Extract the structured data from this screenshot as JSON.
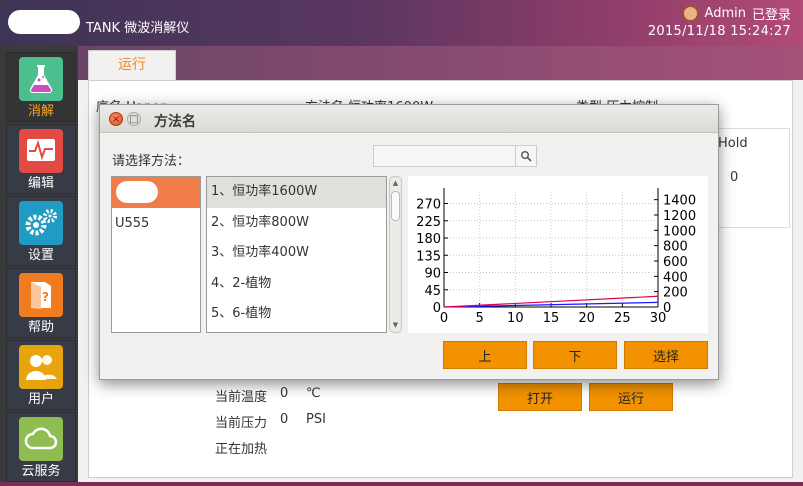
{
  "app": {
    "title": "TANK 微波消解仪",
    "user": "Admin",
    "login_status": "已登录",
    "datetime": "2015/11/18 15:24:27"
  },
  "sidebar": {
    "items": [
      {
        "label": "消解",
        "icon": "flask-icon",
        "active": true
      },
      {
        "label": "编辑",
        "icon": "waveform-edit-icon"
      },
      {
        "label": "设置",
        "icon": "gears-icon"
      },
      {
        "label": "帮助",
        "icon": "help-book-icon"
      },
      {
        "label": "用户",
        "icon": "users-icon"
      },
      {
        "label": "云服务",
        "icon": "cloud-icon"
      }
    ]
  },
  "main": {
    "tab": "运行",
    "sample_name": "序名 Hapon",
    "method_name": "方法名 恒功率1600W",
    "type": "类型 压力控制",
    "hold_label": "Hold",
    "hold_value": "0",
    "current_temp_label": "当前温度",
    "current_temp_value": "0",
    "current_temp_unit": "℃",
    "current_pressure_label": "当前压力",
    "current_pressure_value": "0",
    "current_pressure_unit": "PSI",
    "status_text": "正在加热",
    "open_button": "打开",
    "run_button": "运行"
  },
  "dialog": {
    "title": "方法名",
    "close_glyph": "×",
    "max_glyph": "□",
    "select_label": "请选择方法：",
    "search_placeholder": "",
    "categories": [
      "U555"
    ],
    "methods": [
      "1、恒功率1600W",
      "2、恒功率800W",
      "3、恒功率400W",
      "4、2-植物",
      "5、6-植物"
    ],
    "buttons": {
      "up": "上",
      "down": "下",
      "select": "选择"
    },
    "colors": {
      "accent": "#f39200",
      "selected_category": "#f07c48"
    }
  },
  "chart_data": {
    "type": "line",
    "title": "",
    "xlabel": "",
    "ylabel": "",
    "x_ticks": [
      "0",
      "5",
      "10",
      "15",
      "20",
      "25",
      "30"
    ],
    "y_left_ticks": [
      "0",
      "45",
      "90",
      "135",
      "180",
      "225",
      "270"
    ],
    "y_right_ticks": [
      "0",
      "200",
      "400",
      "600",
      "800",
      "1000",
      "1200",
      "1400"
    ],
    "xlim": [
      0,
      30
    ],
    "ylim_left": [
      0,
      300
    ],
    "ylim_right": [
      0,
      1500
    ],
    "grid": true,
    "series": [
      {
        "axis": "left",
        "color": "#1a1aff",
        "x": [
          0,
          30
        ],
        "y": [
          0,
          12
        ]
      },
      {
        "axis": "right",
        "color": "#e0005a",
        "x": [
          0,
          30
        ],
        "y": [
          0,
          140
        ]
      }
    ]
  }
}
